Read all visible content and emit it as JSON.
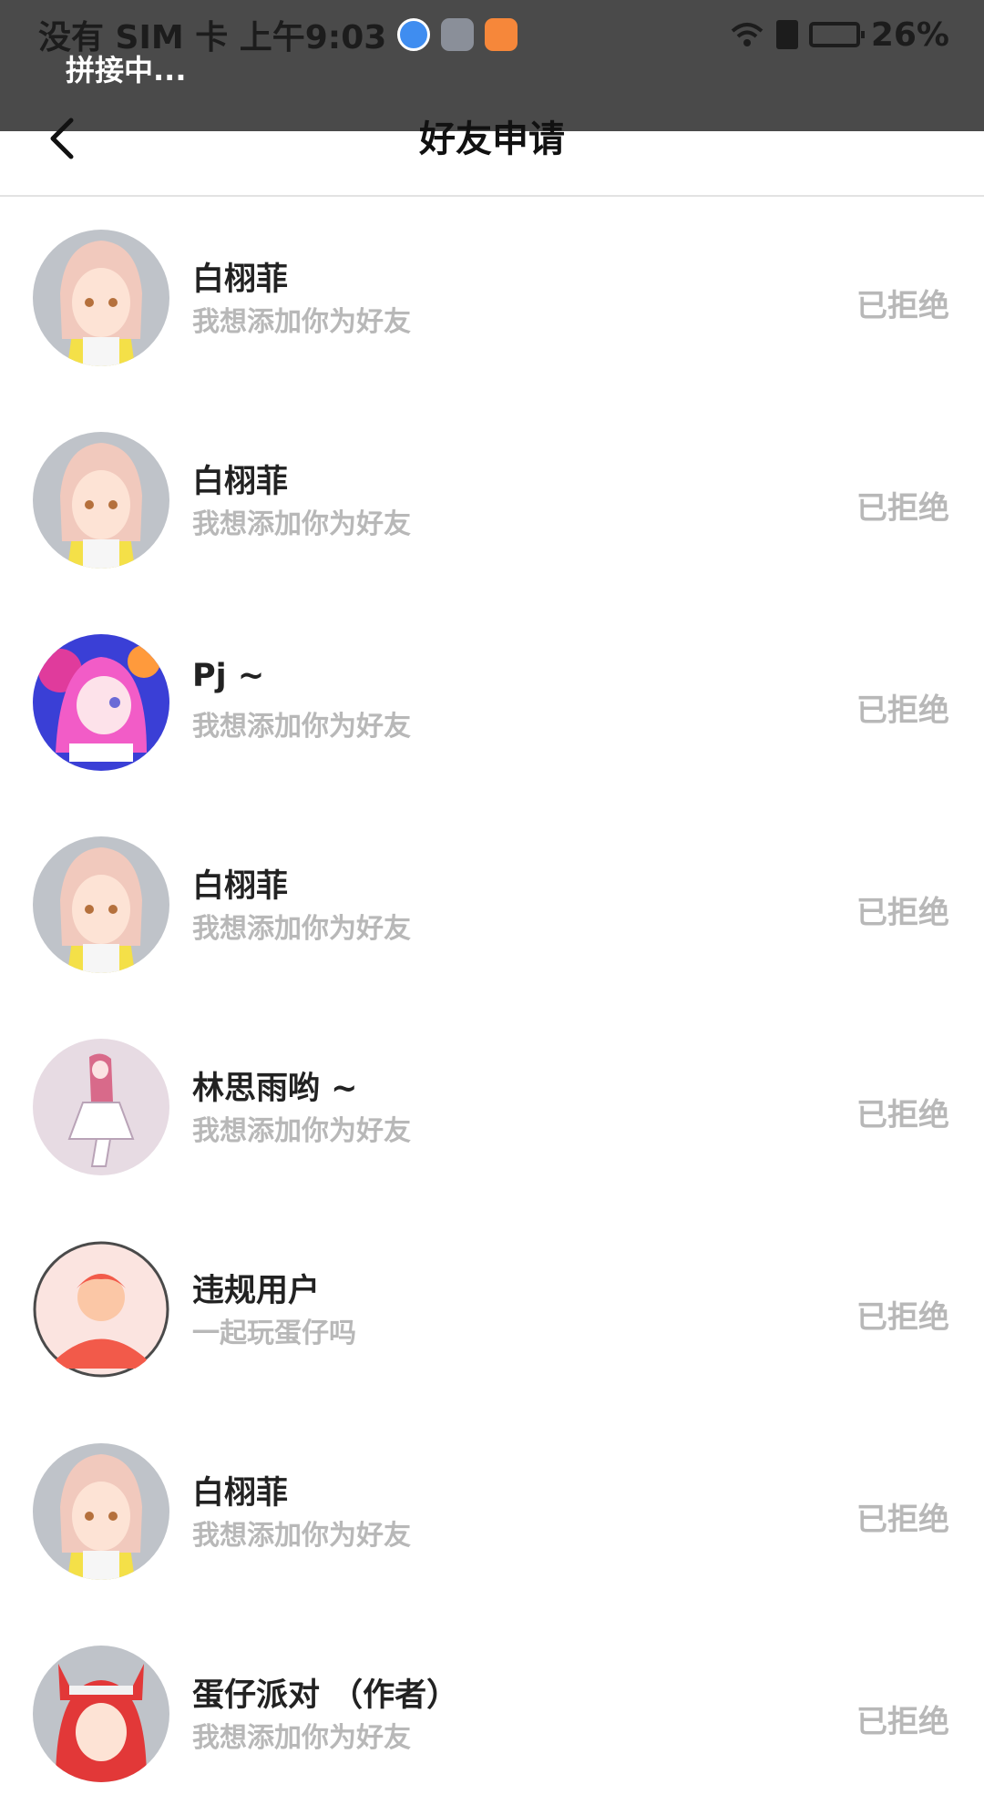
{
  "status_bar": {
    "carrier_time": "没有 SIM 卡 上午9:03",
    "battery": "26%",
    "toast": "拼接中..."
  },
  "header": {
    "title": "好友申请"
  },
  "requests": [
    {
      "name": "白栩菲",
      "message": "我想添加你为好友",
      "status": "已拒绝",
      "avatar": "anime-girl-pink-hair"
    },
    {
      "name": "白栩菲",
      "message": "我想添加你为好友",
      "status": "已拒绝",
      "avatar": "anime-girl-pink-hair"
    },
    {
      "name": "Pj ~",
      "message": "我想添加你为好友",
      "status": "已拒绝",
      "avatar": "anime-girl-colorful"
    },
    {
      "name": "白栩菲",
      "message": "我想添加你为好友",
      "status": "已拒绝",
      "avatar": "anime-girl-pink-hair"
    },
    {
      "name": "林思雨哟 ~",
      "message": "我想添加你为好友",
      "status": "已拒绝",
      "avatar": "anime-girl-sitting"
    },
    {
      "name": "违规用户",
      "message": "一起玩蛋仔吗",
      "status": "已拒绝",
      "avatar": "default-user-placeholder"
    },
    {
      "name": "白栩菲",
      "message": "我想添加你为好友",
      "status": "已拒绝",
      "avatar": "anime-girl-pink-hair"
    },
    {
      "name": "蛋仔派对 （作者）",
      "message": "我想添加你为好友",
      "status": "已拒绝",
      "avatar": "anime-girl-red-hair-cat-ears"
    }
  ],
  "colors": {
    "status_bar_bg": "#4a4a4a",
    "secondary_text": "#b8b8b8",
    "primary_text": "#222222"
  }
}
